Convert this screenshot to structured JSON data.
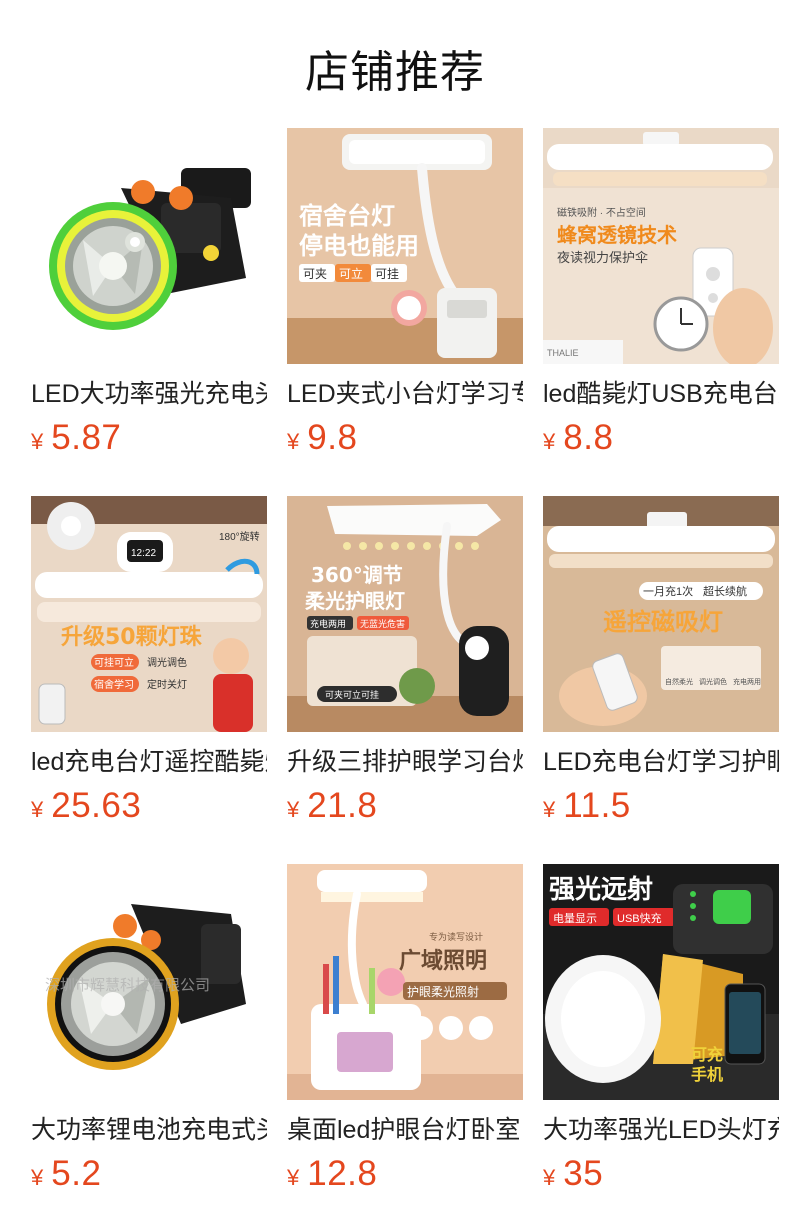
{
  "page": {
    "title": "店铺推荐"
  },
  "colors": {
    "price": "#e4471e",
    "title": "#111111",
    "product_name": "#222222",
    "background": "#ffffff"
  },
  "products": [
    {
      "name": "LED大功率强光充电头灯",
      "currency": "¥",
      "price": "5.87",
      "image": {
        "icon": "headlamp-green-icon",
        "texts": []
      }
    },
    {
      "name": "LED夹式小台灯学习专用",
      "currency": "¥",
      "price": "9.8",
      "image": {
        "icon": "clip-desk-lamp-icon",
        "texts": [
          "宿舍台灯",
          "停电也能用",
          "可夹",
          "可立",
          "可挂"
        ]
      }
    },
    {
      "name": "led酷毙灯USB充电台灯",
      "currency": "¥",
      "price": "8.8",
      "image": {
        "icon": "magnetic-bar-lamp-icon",
        "texts": [
          "磁铁吸附 · 不占空间",
          "蜂窝透镜技术",
          "夜读视力保护伞",
          "THALIE"
        ]
      }
    },
    {
      "name": "led充电台灯遥控酷毙灯",
      "currency": "¥",
      "price": "25.63",
      "image": {
        "icon": "remote-bar-lamp-icon",
        "texts": [
          "12:22",
          "180°旋转",
          "升级50颗灯珠",
          "可挂可立",
          "调光调色",
          "宿舍学习",
          "定时关灯"
        ]
      }
    },
    {
      "name": "升级三排护眼学习台灯",
      "currency": "¥",
      "price": "21.8",
      "image": {
        "icon": "gooseneck-clip-lamp-icon",
        "texts": [
          "360°调节",
          "柔光护眼灯",
          "充电两用",
          "无蓝光危害",
          "可夹可立可挂"
        ]
      }
    },
    {
      "name": "LED充电台灯学习护眼",
      "currency": "¥",
      "price": "11.5",
      "image": {
        "icon": "remote-magnetic-lamp-icon",
        "texts": [
          "一月充1次",
          "超长续航",
          "遥控磁吸灯",
          "自然柔光",
          "调光调色",
          "充电两用"
        ]
      }
    },
    {
      "name": "大功率锂电池充电式头灯",
      "currency": "¥",
      "price": "5.2",
      "image": {
        "icon": "headlamp-gold-icon",
        "texts": [
          "深圳市辉慧科技有限公司"
        ]
      }
    },
    {
      "name": "桌面led护眼台灯卧室",
      "currency": "¥",
      "price": "12.8",
      "image": {
        "icon": "pen-holder-lamp-icon",
        "texts": [
          "专为读写设计",
          "广域照明",
          "护眼柔光照射"
        ]
      }
    },
    {
      "name": "大功率强光LED头灯充电",
      "currency": "¥",
      "price": "35",
      "image": {
        "icon": "headlamp-power-bank-icon",
        "texts": [
          "强光远射",
          "电量显示",
          "USB快充",
          "可充",
          "手机"
        ]
      }
    }
  ]
}
